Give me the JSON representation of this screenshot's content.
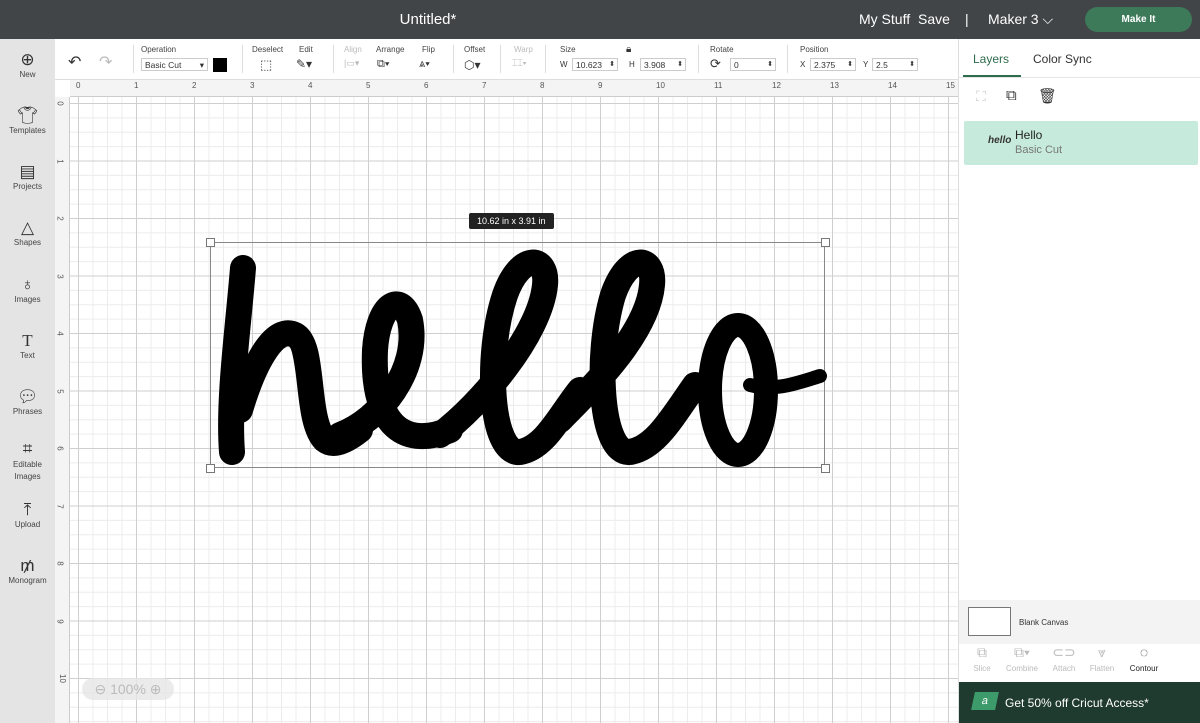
{
  "header": {
    "title": "Untitled*",
    "my_stuff": "My Stuff",
    "save": "Save",
    "separator": "|",
    "machine": "Maker 3",
    "make_it": "Make It"
  },
  "sidebar": {
    "items": [
      {
        "label": "New",
        "icon": "plus-circle-icon"
      },
      {
        "label": "Templates",
        "icon": "shirt-icon"
      },
      {
        "label": "Projects",
        "icon": "clipboard-icon"
      },
      {
        "label": "Shapes",
        "icon": "shapes-icon"
      },
      {
        "label": "Images",
        "icon": "lightbulb-icon"
      },
      {
        "label": "Text",
        "icon": "text-icon"
      },
      {
        "label": "Phrases",
        "icon": "speech-icon"
      },
      {
        "label": "Editable Images",
        "icon": "edit-nodes-icon"
      },
      {
        "label": "Upload",
        "icon": "upload-icon"
      },
      {
        "label": "Monogram",
        "icon": "monogram-icon"
      }
    ]
  },
  "toolbar": {
    "operation_label": "Operation",
    "operation_value": "Basic Cut",
    "operation_color": "#000000",
    "deselect": "Deselect",
    "edit": "Edit",
    "align": "Align",
    "arrange": "Arrange",
    "flip": "Flip",
    "offset": "Offset",
    "warp": "Warp",
    "size_label": "Size",
    "w_label": "W",
    "w_value": "10.623",
    "h_label": "H",
    "h_value": "3.908",
    "rotate_label": "Rotate",
    "rotate_value": "0",
    "position_label": "Position",
    "x_label": "X",
    "x_value": "2.375",
    "y_label": "Y",
    "y_value": "2.5"
  },
  "rulers": {
    "top": [
      "0",
      "1",
      "2",
      "3",
      "4",
      "5",
      "6",
      "7",
      "8",
      "9",
      "10",
      "11",
      "12",
      "13",
      "14",
      "15"
    ],
    "left": [
      "0",
      "1",
      "2",
      "3",
      "4",
      "5",
      "6",
      "7",
      "8",
      "9",
      "10"
    ]
  },
  "canvas": {
    "dimension_tooltip": "10.62  in x 3.91  in",
    "zoom": "100%",
    "text": "hello"
  },
  "panel": {
    "tabs": [
      "Layers",
      "Color Sync"
    ],
    "layer": {
      "name": "Hello",
      "operation": "Basic Cut"
    },
    "blank_canvas": "Blank Canvas",
    "tools": [
      "Slice",
      "Combine",
      "Attach",
      "Flatten",
      "Contour"
    ],
    "promo": "Get 50% off Cricut Access*",
    "accent": "#3d7a5a"
  }
}
